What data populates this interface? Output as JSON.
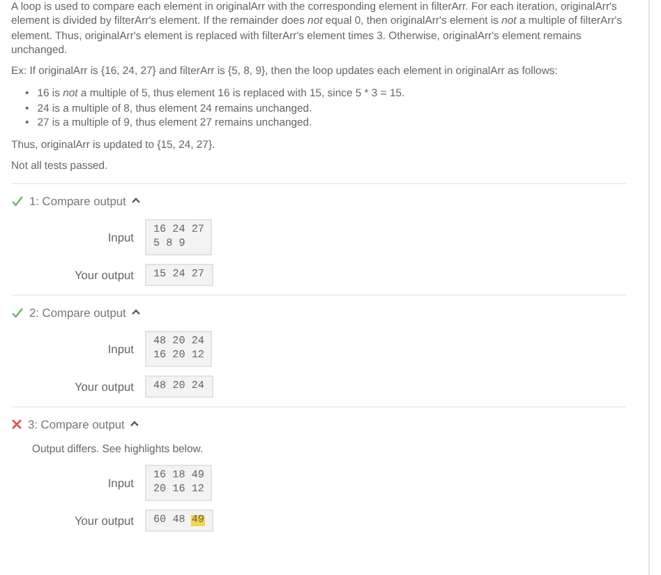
{
  "description": "A loop is used to compare each element in originalArr with the corresponding element in filterArr. For each iteration, originalArr's element is divided by filterArr's element. If the remainder does *not* equal 0, then originalArr's element is *not* a multiple of filterArr's element. Thus, originalArr's element is replaced with filterArr's element times 3. Otherwise, originalArr's element remains unchanged.",
  "example": "Ex: If originalArr is {16, 24, 27} and filterArr is {5, 8, 9}, then the loop updates each element in originalArr as follows:",
  "bullets": [
    {
      "marker": "•",
      "text": "16 is *not* a multiple of 5, thus element 16 is replaced with 15, since 5 * 3 = 15."
    },
    {
      "marker": "•",
      "text": "24 is a multiple of 8, thus element 24 remains unchanged."
    },
    {
      "marker": "•",
      "text": "27 is a multiple of 9, thus element 27 remains unchanged."
    }
  ],
  "conclusion": "Thus, originalArr is updated to {15, 24, 27}.",
  "status": "Not all tests passed.",
  "tests": [
    {
      "title": "1: Compare output",
      "passed": true,
      "expanded": true,
      "input_label": "Input",
      "input": [
        "16 24 27",
        "5 8 9"
      ],
      "output_label": "Your output",
      "output": [
        {
          "text": "15",
          "highlighted": false
        },
        {
          "text": "24",
          "highlighted": false
        },
        {
          "text": "27",
          "highlighted": false
        }
      ]
    },
    {
      "title": "2: Compare output",
      "passed": true,
      "expanded": true,
      "input_label": "Input",
      "input": [
        "48 20 24",
        "16 20 12"
      ],
      "output_label": "Your output",
      "output": [
        {
          "text": "48",
          "highlighted": false
        },
        {
          "text": "20",
          "highlighted": false
        },
        {
          "text": "24",
          "highlighted": false
        }
      ]
    },
    {
      "title": "3: Compare output",
      "passed": false,
      "expanded": true,
      "message": "Output differs. See highlights below.",
      "input_label": "Input",
      "input": [
        "16 18 49",
        "20 16 12"
      ],
      "output_label": "Your output",
      "output": [
        {
          "text": "60",
          "highlighted": false
        },
        {
          "text": "48",
          "highlighted": false
        },
        {
          "text": "49",
          "highlighted": true
        }
      ]
    }
  ]
}
